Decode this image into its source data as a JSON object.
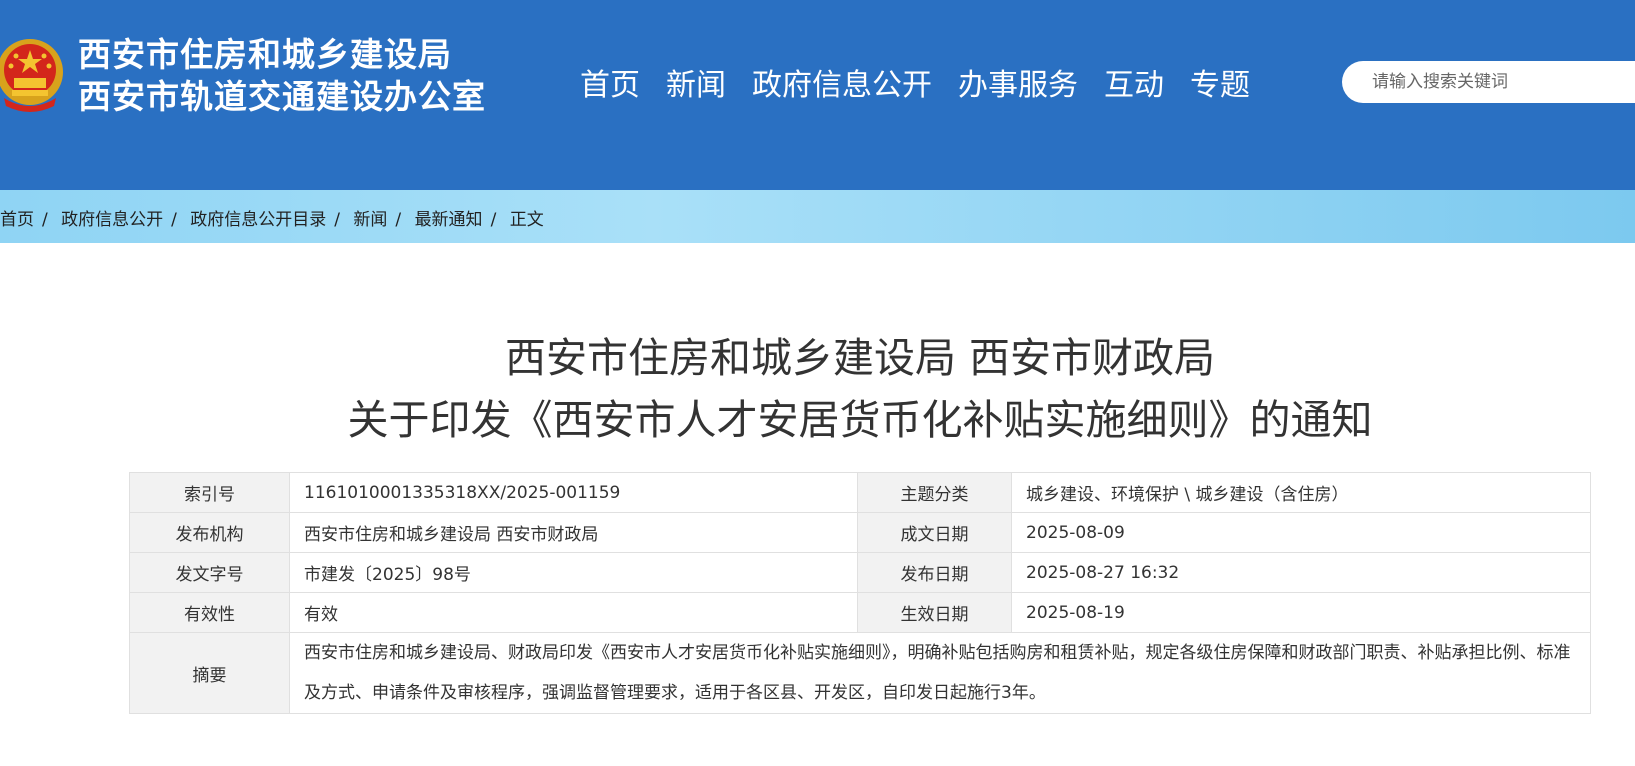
{
  "header": {
    "title_line1": "西安市住房和城乡建设局",
    "title_line2": "西安市轨道交通建设办公室",
    "emblem_icon": "national-emblem-icon",
    "nav": [
      "首页",
      "新闻",
      "政府信息公开",
      "办事服务",
      "互动",
      "专题"
    ],
    "search_placeholder": "请输入搜索关键词",
    "color_primary": "#2a70c2"
  },
  "breadcrumb": [
    "首页",
    "政府信息公开",
    "政府信息公开目录",
    "新闻",
    "最新通知",
    "正文"
  ],
  "document": {
    "title_line1": "西安市住房和城乡建设局 西安市财政局",
    "title_line2": "关于印发《西安市人才安居货币化补贴实施细则》的通知"
  },
  "meta": {
    "index_label": "索引号",
    "index_value": "1161010001335318XX/2025-001159",
    "topic_label": "主题分类",
    "topic_value": "城乡建设、环境保护 \\ 城乡建设（含住房）",
    "publisher_label": "发布机构",
    "publisher_value": "西安市住房和城乡建设局 西安市财政局",
    "written_date_label": "成文日期",
    "written_date_value": "2025-08-09",
    "doc_no_label": "发文字号",
    "doc_no_value": "市建发〔2025〕98号",
    "publish_date_label": "发布日期",
    "publish_date_value": "2025-08-27 16:32",
    "validity_label": "有效性",
    "validity_value": "有效",
    "effective_date_label": "生效日期",
    "effective_date_value": "2025-08-19",
    "summary_label": "摘要",
    "summary_value": "西安市住房和城乡建设局、财政局印发《西安市人才安居货币化补贴实施细则》，明确补贴包括购房和租赁补贴，规定各级住房保障和财政部门职责、补贴承担比例、标准及方式、申请条件及审核程序，强调监督管理要求，适用于各区县、开发区，自印发日起施行3年。"
  }
}
